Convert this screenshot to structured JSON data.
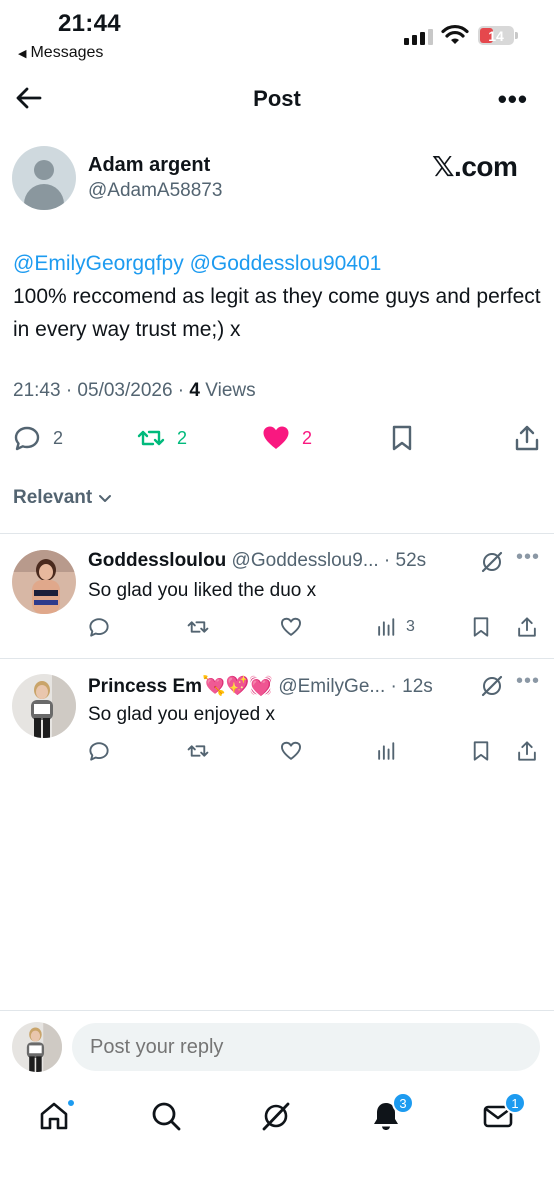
{
  "status_bar": {
    "time": "21:44",
    "back_label": "Messages",
    "battery": "14"
  },
  "header": {
    "title": "Post",
    "more": "•••"
  },
  "post": {
    "author_name": "Adam argent",
    "author_handle": "@AdamA58873",
    "brand": "𝕏.com",
    "mention1": "@EmilyGeorgqfpy",
    "mention2": "@Goddesslou90401",
    "body": "100% reccomend as legit as they come guys and perfect in every way trust me;) x",
    "timestamp": "21:43 · 05/03/2026 · ",
    "views_count": "4",
    "views_label": " Views",
    "replies": "2",
    "reposts": "2",
    "likes": "2"
  },
  "sort": {
    "label": "Relevant"
  },
  "replies": [
    {
      "name": "Goddessloulou",
      "handle": " @Goddesslou9... · 52s",
      "text": "So glad you liked the duo x",
      "views": "3"
    },
    {
      "name": "Princess Em💘💖💓",
      "handle": " @EmilyGe... · 12s",
      "text": "So glad you enjoyed x",
      "views": ""
    }
  ],
  "reply_bar": {
    "placeholder": "Post your reply"
  },
  "tabbar": {
    "notifications_badge": "3",
    "messages_badge": "1"
  },
  "colors": {
    "accent": "#1d9bf0",
    "repost": "#00ba7c",
    "like": "#f91880",
    "secondary_text": "#536471"
  }
}
